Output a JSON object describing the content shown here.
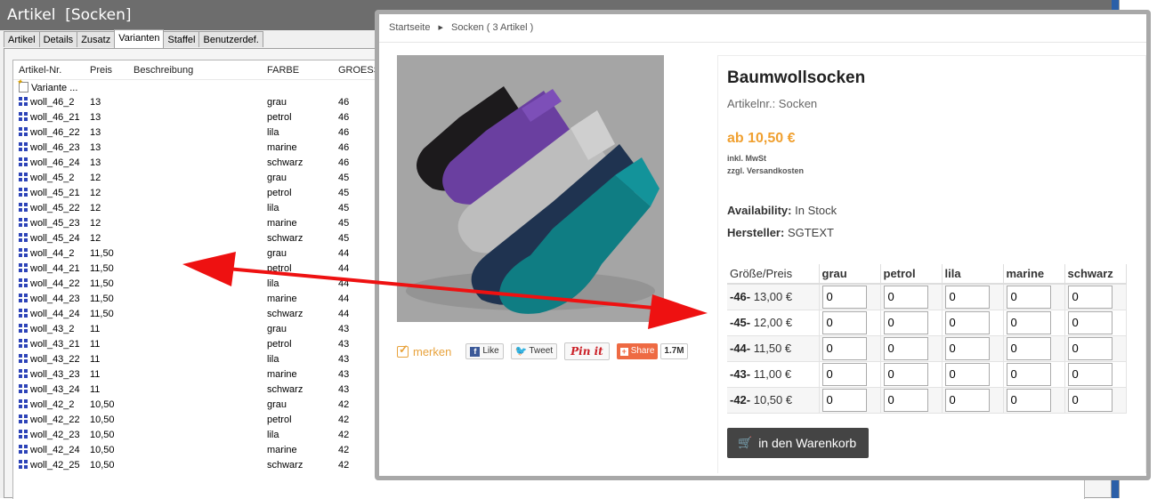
{
  "erp": {
    "title": "Artikel  [Socken]",
    "tabs": [
      "Artikel",
      "Details",
      "Zusatz",
      "Varianten",
      "Staffel",
      "Benutzerdef."
    ],
    "active_tab": "Varianten",
    "columns": [
      "Artikel-Nr.",
      "Preis",
      "Beschreibung",
      "FARBE",
      "GROESS"
    ],
    "new_variant": "Variante ...",
    "rows": [
      [
        "woll_46_2",
        "13",
        "",
        "grau",
        "46"
      ],
      [
        "woll_46_21",
        "13",
        "",
        "petrol",
        "46"
      ],
      [
        "woll_46_22",
        "13",
        "",
        "lila",
        "46"
      ],
      [
        "woll_46_23",
        "13",
        "",
        "marine",
        "46"
      ],
      [
        "woll_46_24",
        "13",
        "",
        "schwarz",
        "46"
      ],
      [
        "woll_45_2",
        "12",
        "",
        "grau",
        "45"
      ],
      [
        "woll_45_21",
        "12",
        "",
        "petrol",
        "45"
      ],
      [
        "woll_45_22",
        "12",
        "",
        "lila",
        "45"
      ],
      [
        "woll_45_23",
        "12",
        "",
        "marine",
        "45"
      ],
      [
        "woll_45_24",
        "12",
        "",
        "schwarz",
        "45"
      ],
      [
        "woll_44_2",
        "11,50",
        "",
        "grau",
        "44"
      ],
      [
        "woll_44_21",
        "11,50",
        "",
        "petrol",
        "44"
      ],
      [
        "woll_44_22",
        "11,50",
        "",
        "lila",
        "44"
      ],
      [
        "woll_44_23",
        "11,50",
        "",
        "marine",
        "44"
      ],
      [
        "woll_44_24",
        "11,50",
        "",
        "schwarz",
        "44"
      ],
      [
        "woll_43_2",
        "11",
        "",
        "grau",
        "43"
      ],
      [
        "woll_43_21",
        "11",
        "",
        "petrol",
        "43"
      ],
      [
        "woll_43_22",
        "11",
        "",
        "lila",
        "43"
      ],
      [
        "woll_43_23",
        "11",
        "",
        "marine",
        "43"
      ],
      [
        "woll_43_24",
        "11",
        "",
        "schwarz",
        "43"
      ],
      [
        "woll_42_2",
        "10,50",
        "",
        "grau",
        "42"
      ],
      [
        "woll_42_22",
        "10,50",
        "",
        "petrol",
        "42"
      ],
      [
        "woll_42_23",
        "10,50",
        "",
        "lila",
        "42"
      ],
      [
        "woll_42_24",
        "10,50",
        "",
        "marine",
        "42"
      ],
      [
        "woll_42_25",
        "10,50",
        "",
        "schwarz",
        "42"
      ]
    ]
  },
  "shop": {
    "breadcrumb": {
      "home": "Startseite",
      "category": "Socken ( 3 Artikel )"
    },
    "product_name": "Baumwollsocken",
    "article_number": "Artikelnr.: Socken",
    "price": "ab 10,50 €",
    "vat_note": "inkl. MwSt",
    "shipping_note": "zzgl. Versandkosten",
    "availability_label": "Availability:",
    "availability_value": "In Stock",
    "manufacturer_label": "Hersteller:",
    "manufacturer_value": "SGTEXT",
    "social": {
      "bookmark": "merken",
      "like": "Like",
      "tweet": "Tweet",
      "pin": "Pin it",
      "share": "Share",
      "share_count": "1.7M"
    },
    "grid": {
      "corner": "Größe/Preis",
      "colors": [
        "grau",
        "petrol",
        "lila",
        "marine",
        "schwarz"
      ],
      "rows": [
        {
          "size": "-46-",
          "price": " 13,00 €",
          "qty": [
            "0",
            "0",
            "0",
            "0",
            "0"
          ]
        },
        {
          "size": "-45-",
          "price": " 12,00 €",
          "qty": [
            "0",
            "0",
            "0",
            "0",
            "0"
          ]
        },
        {
          "size": "-44-",
          "price": " 11,50 €",
          "qty": [
            "0",
            "0",
            "0",
            "0",
            "0"
          ]
        },
        {
          "size": "-43-",
          "price": " 11,00 €",
          "qty": [
            "0",
            "0",
            "0",
            "0",
            "0"
          ]
        },
        {
          "size": "-42-",
          "price": " 10,50 €",
          "qty": [
            "0",
            "0",
            "0",
            "0",
            "0"
          ]
        }
      ]
    },
    "cart_button": "in den Warenkorb",
    "icons": {
      "cart": "cart-icon",
      "bookmark": "checkbox-icon",
      "breadcrumb_sep": "triangle-right-icon"
    },
    "colors": {
      "price": "#f0a030",
      "cart_bg": "#444444",
      "annotation_arrow": "#ee1111"
    }
  }
}
